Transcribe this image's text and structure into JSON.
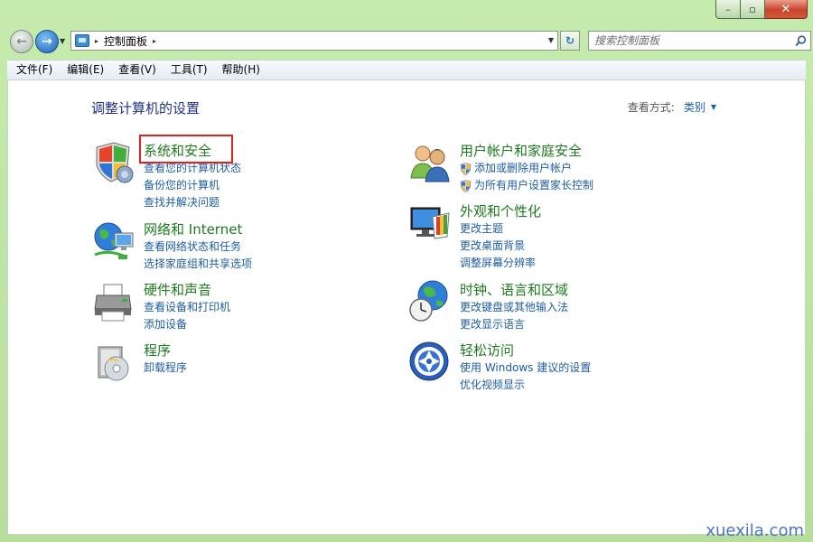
{
  "window": {
    "controls": {
      "minimize": "–",
      "maximize": "▫",
      "close": "✕"
    }
  },
  "navbar": {
    "address": {
      "separator": "▸",
      "path": "控制面板",
      "end_separator": "▸"
    },
    "search": {
      "placeholder": "搜索控制面板"
    }
  },
  "menubar": {
    "items": [
      {
        "label": "文件(F)"
      },
      {
        "label": "编辑(E)"
      },
      {
        "label": "查看(V)"
      },
      {
        "label": "工具(T)"
      },
      {
        "label": "帮助(H)"
      }
    ]
  },
  "main": {
    "title": "调整计算机的设置",
    "view_by": {
      "label": "查看方式:",
      "value": "类别"
    },
    "categories": [
      {
        "title": "系统和安全",
        "icon": "security-shield-icon",
        "links": [
          "查看您的计算机状态",
          "备份您的计算机",
          "查找并解决问题"
        ]
      },
      {
        "title": "网络和 Internet",
        "icon": "network-globe-icon",
        "links": [
          "查看网络状态和任务",
          "选择家庭组和共享选项"
        ]
      },
      {
        "title": "硬件和声音",
        "icon": "printer-icon",
        "links": [
          "查看设备和打印机",
          "添加设备"
        ]
      },
      {
        "title": "程序",
        "icon": "programs-disc-icon",
        "links": [
          "卸载程序"
        ]
      },
      {
        "title": "用户帐户和家庭安全",
        "icon": "users-icon",
        "links": [
          "添加或删除用户帐户",
          "为所有用户设置家长控制"
        ]
      },
      {
        "title": "外观和个性化",
        "icon": "monitor-palette-icon",
        "links": [
          "更改主题",
          "更改桌面背景",
          "调整屏幕分辨率"
        ]
      },
      {
        "title": "时钟、语言和区域",
        "icon": "clock-globe-icon",
        "links": [
          "更改键盘或其他输入法",
          "更改显示语言"
        ]
      },
      {
        "title": "轻松访问",
        "icon": "ease-of-access-icon",
        "links": [
          "使用 Windows 建议的设置",
          "优化视频显示"
        ]
      }
    ]
  },
  "watermark": "xuexila.com",
  "colors": {
    "category_title": "#1e7a1e",
    "link": "#1e5da3",
    "page_title": "#1e3287",
    "highlight": "#e0201f"
  }
}
